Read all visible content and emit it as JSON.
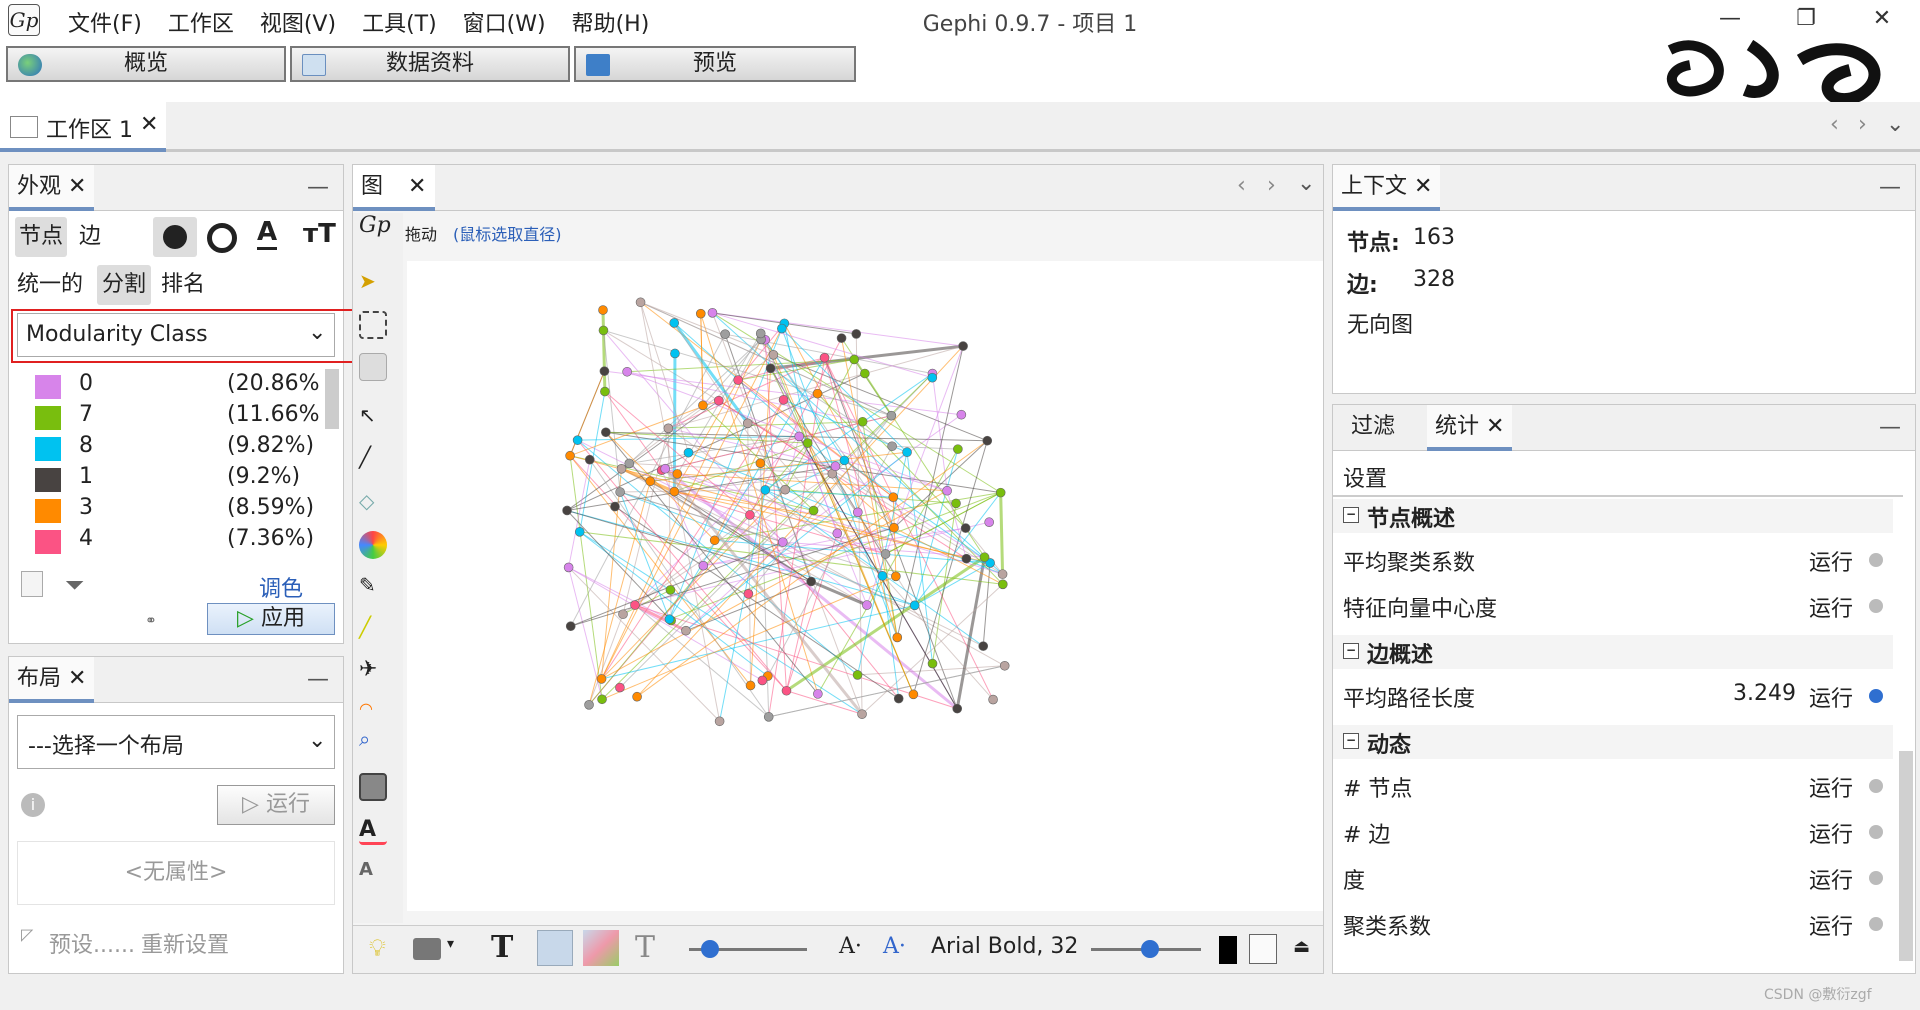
{
  "window": {
    "logo": "Gp",
    "title": "Gephi 0.9.7 - 项目 1",
    "controls": {
      "minimize": "—",
      "maximize": "❐",
      "close": "✕"
    }
  },
  "menu": [
    "文件(F)",
    "工作区",
    "视图(V)",
    "工具(T)",
    "窗口(W)",
    "帮助(H)"
  ],
  "modes": [
    {
      "label": "概览"
    },
    {
      "label": "数据资料"
    },
    {
      "label": "预览"
    }
  ],
  "workspace_tab": {
    "label": "工作区 1",
    "close": "✕"
  },
  "appearance": {
    "title": "外观",
    "close": "✕",
    "min": "—",
    "tabs": [
      "节点",
      "边"
    ],
    "sub_tabs": [
      "统一的",
      "分割",
      "排名"
    ],
    "attribute": "Modularity Class",
    "legend": [
      {
        "label": "0",
        "pct": "(20.86%)",
        "color": "#d784ea"
      },
      {
        "label": "7",
        "pct": "(11.66%)",
        "color": "#79be0e"
      },
      {
        "label": "8",
        "pct": "(9.82%)",
        "color": "#00c2f0"
      },
      {
        "label": "1",
        "pct": "(9.2%)",
        "color": "#484341"
      },
      {
        "label": "3",
        "pct": "(8.59%)",
        "color": "#ff8a00"
      },
      {
        "label": "4",
        "pct": "(7.36%)",
        "color": "#fb5384"
      }
    ],
    "palette_link": "调色板...",
    "apply": "应用"
  },
  "layout": {
    "title": "布局",
    "close": "✕",
    "min": "—",
    "select": "---选择一个布局",
    "run": "运行",
    "no_props": "<无属性>",
    "presets": "预设......",
    "reset": "重新设置"
  },
  "graph": {
    "tab": "图",
    "close": "✕",
    "mode_label": "拖动",
    "mode_hint": "(鼠标选取直径)",
    "font_label": "Arial Bold, 32"
  },
  "context": {
    "title": "上下文",
    "close": "✕",
    "min": "—",
    "nodes_label": "节点:",
    "nodes_value": "163",
    "edges_label": "边:",
    "edges_value": "328",
    "graph_type": "无向图"
  },
  "stats": {
    "tabs": [
      "过滤",
      "统计"
    ],
    "close": "✕",
    "min": "—",
    "settings": "设置",
    "sections": [
      {
        "title": "节点概述",
        "rows": [
          {
            "name": "平均聚类系数",
            "value": "",
            "run": "运行"
          },
          {
            "name": "特征向量中心度",
            "value": "",
            "run": "运行"
          }
        ]
      },
      {
        "title": "边概述",
        "rows": [
          {
            "name": "平均路径长度",
            "value": "3.249",
            "run": "运行"
          }
        ]
      },
      {
        "title": "动态",
        "rows": [
          {
            "name": "# 节点",
            "value": "",
            "run": "运行"
          },
          {
            "name": "# 边",
            "value": "",
            "run": "运行"
          },
          {
            "name": "度",
            "value": "",
            "run": "运行"
          },
          {
            "name": "聚类系数",
            "value": "",
            "run": "运行"
          }
        ]
      }
    ]
  },
  "watermark": "CSDN @敷衍zgf",
  "colors": {
    "accent": "#6e90c0",
    "highlight_border": "#e02020"
  }
}
